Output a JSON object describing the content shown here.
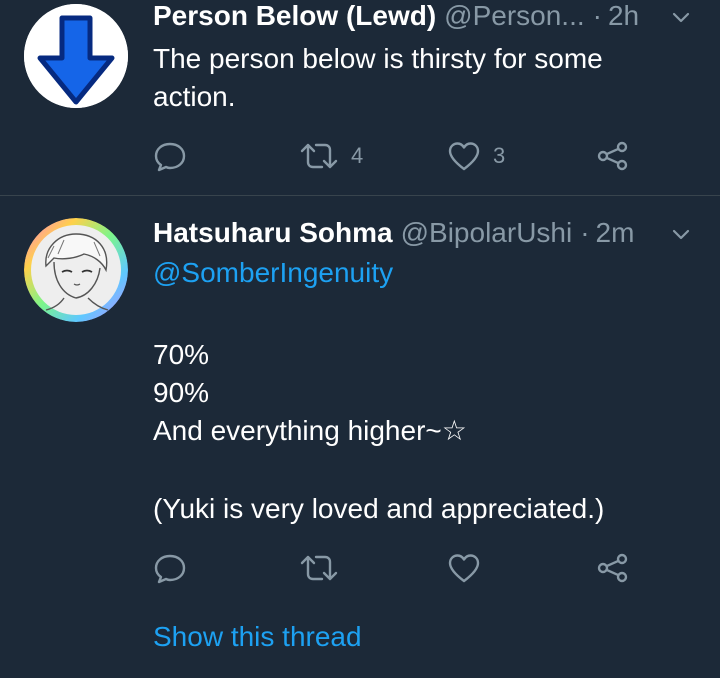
{
  "tweets": [
    {
      "name": "Person Below (Lewd)",
      "handle": "@Person...",
      "dot": "·",
      "time": "2h",
      "lines": [
        "The person below is thirsty for some",
        "action."
      ],
      "retweets": "4",
      "likes": "3",
      "icons": [
        "down-arrow-avatar-icon",
        "chevron-down-icon",
        "reply-icon",
        "retweet-icon",
        "heart-icon",
        "share-icon"
      ]
    },
    {
      "name": "Hatsuharu Sohma",
      "handle": "@BipolarUshi",
      "dot": "·",
      "time": "2m",
      "mention": "@SomberIngenuity",
      "body_lines": [
        "70%",
        "90%",
        "And everything higher~☆",
        "(Yuki is very loved and appreciated.)"
      ],
      "retweets": "",
      "likes": "",
      "show_thread": "Show this thread"
    }
  ],
  "colors": {
    "background": "#1c2938",
    "secondary_text": "#8899a6",
    "link": "#1da1f2",
    "divider": "#38444d",
    "arrow_blue": "#1565e8"
  }
}
